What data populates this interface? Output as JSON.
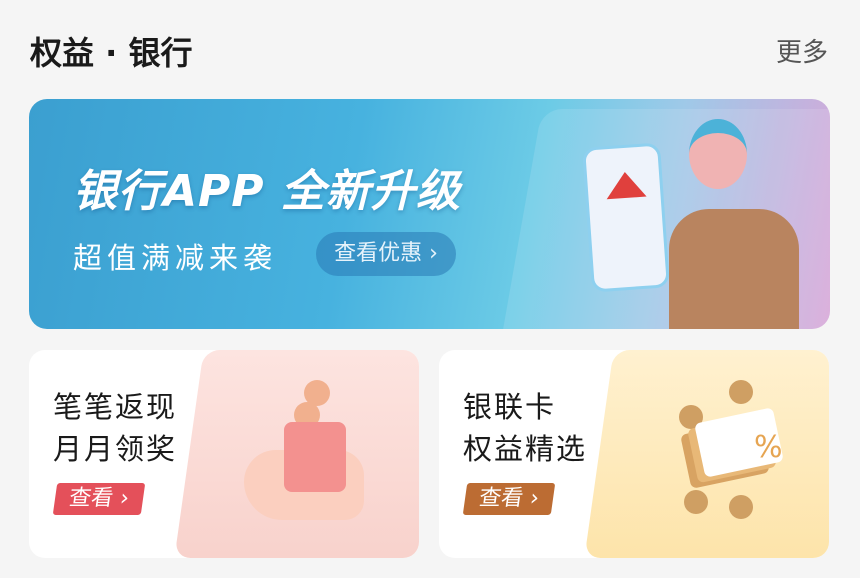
{
  "header": {
    "title": "权益 · 银行",
    "more_label": "更多"
  },
  "banner": {
    "headline": "银行APP 全新升级",
    "subtitle": "超值满减来袭",
    "button_label": "查看优惠 ›"
  },
  "cards": [
    {
      "line1": "笔笔返现",
      "line2": "月月领奖",
      "button_label": "查看 ›",
      "color": "#e4505a"
    },
    {
      "line1": "银联卡",
      "line2": "权益精选",
      "button_label": "查看 ›",
      "color": "#bc6c33"
    }
  ]
}
